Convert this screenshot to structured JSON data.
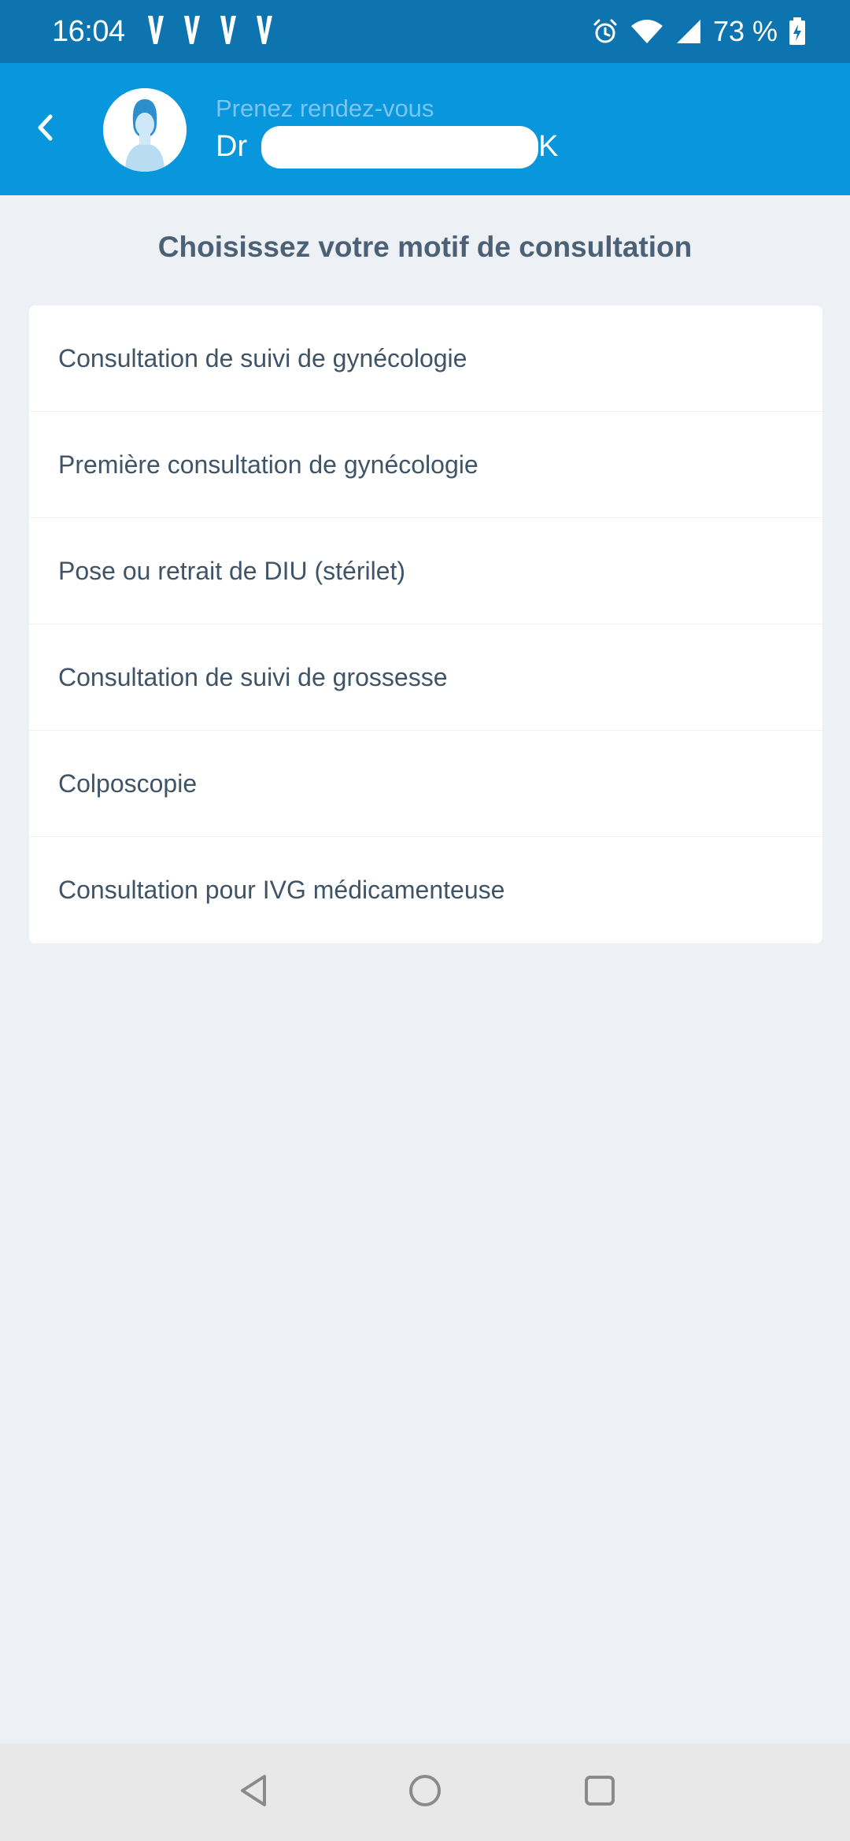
{
  "status_bar": {
    "time": "16:04",
    "notification_icons": [
      "vinted-icon",
      "vinted-icon",
      "vinted-icon",
      "vinted-icon"
    ],
    "battery_percent": "73 %",
    "icons": [
      "alarm-icon",
      "wifi-icon",
      "signal-icon",
      "battery-charging-icon"
    ]
  },
  "header": {
    "back_icon": "chevron-left-icon",
    "avatar_icon": "doctor-avatar-icon",
    "subtitle": "Prenez rendez-vous",
    "title_prefix": "Dr",
    "title_suffix": "K"
  },
  "main": {
    "title": "Choisissez votre motif de consultation",
    "motifs": [
      "Consultation de suivi de gynécologie",
      "Première consultation de gynécologie",
      "Pose ou retrait de DIU (stérilet)",
      "Consultation de suivi de grossesse",
      "Colposcopie",
      "Consultation pour IVG médicamenteuse"
    ]
  },
  "nav_bar": {
    "icons": [
      "back-triangle-icon",
      "home-circle-icon",
      "recents-square-icon"
    ]
  },
  "colors": {
    "status_bar": "#0d74b0",
    "header": "#0896dc",
    "background": "#edf1f5",
    "title_text": "#4c6175",
    "item_text": "#3f5467"
  }
}
